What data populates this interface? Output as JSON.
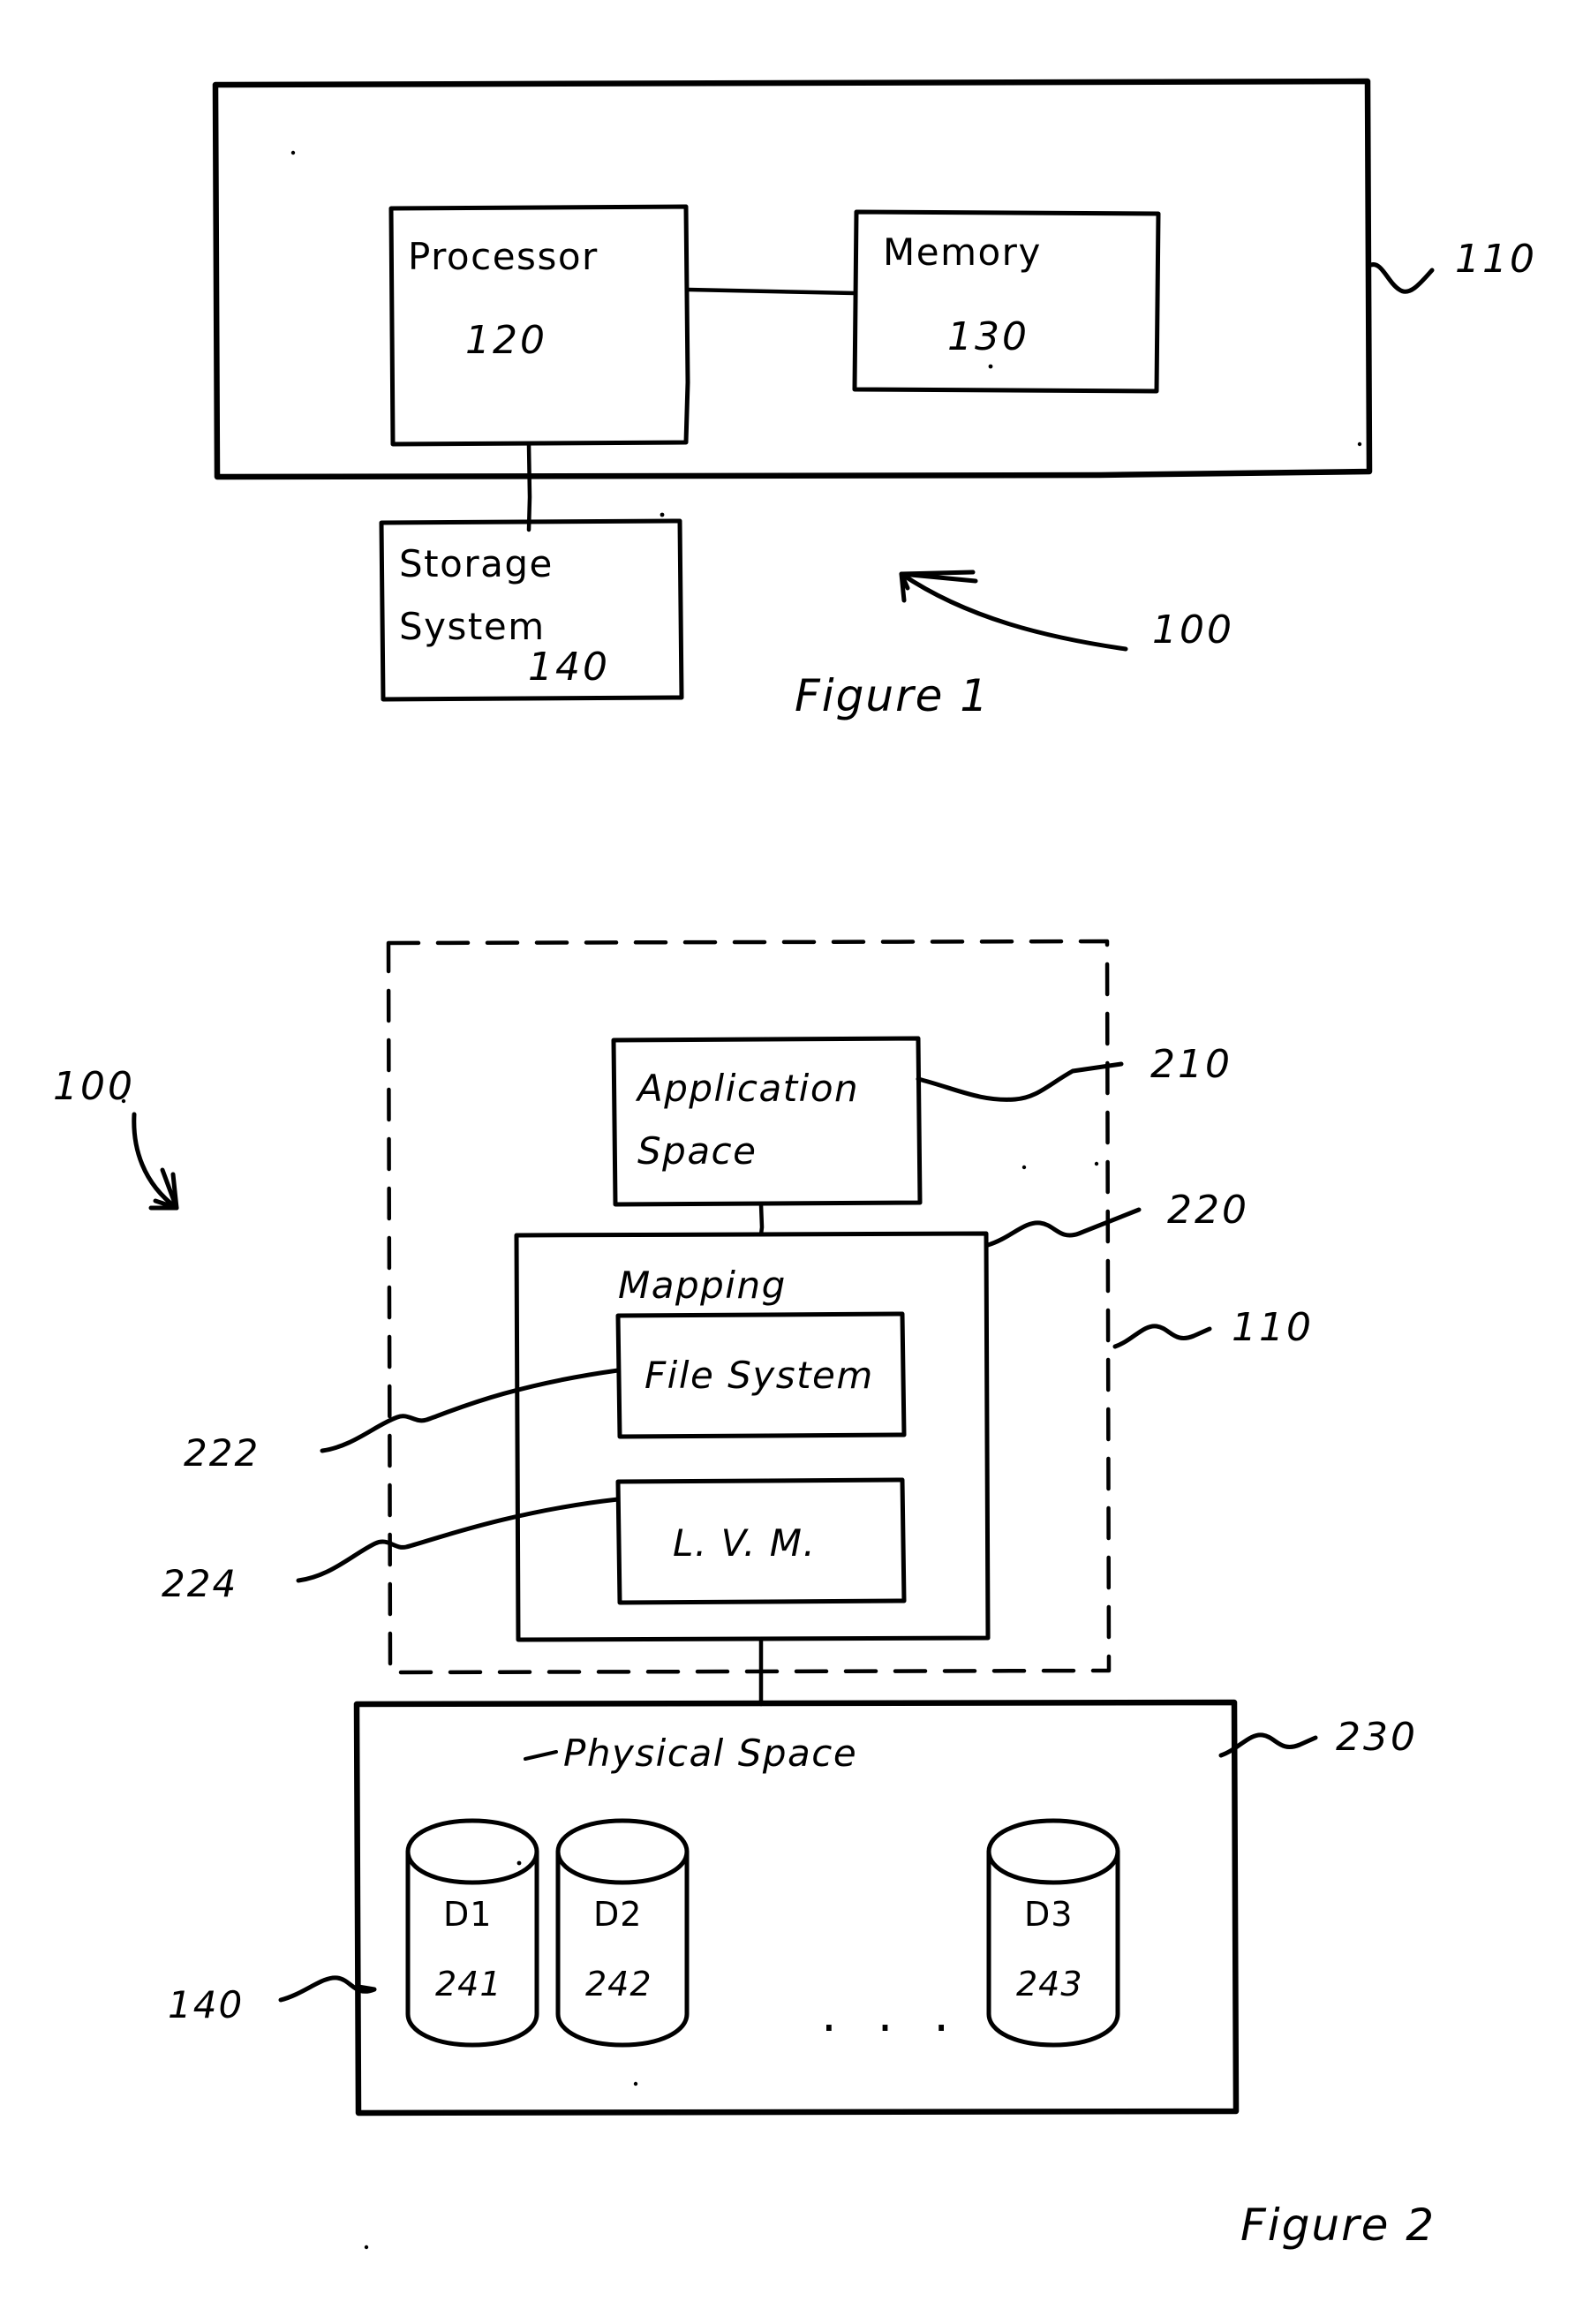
{
  "document": {
    "type": "patent-figure-sheet",
    "background_color": "#ffffff",
    "ink_color": "#000000"
  },
  "figure1": {
    "caption": "Figure 1",
    "system_callout": "100",
    "computer_callout": "110",
    "boxes": {
      "processor": {
        "label": "Processor",
        "number": "120"
      },
      "memory": {
        "label": "Memory",
        "number": "130"
      },
      "storage": {
        "label_line1": "Storage",
        "label_line2": "System",
        "number": "140"
      }
    }
  },
  "figure2": {
    "caption": "Figure 2",
    "system_callout": "100",
    "computer_callout": "110",
    "boxes": {
      "application_space": {
        "label_line1": "Application",
        "label_line2": "Space",
        "number": "210"
      },
      "mapping": {
        "label": "Mapping",
        "number": "220"
      },
      "file_system": {
        "label": "File System",
        "number": "222"
      },
      "lvm": {
        "label": "L. V. M.",
        "number": "224"
      },
      "physical_space": {
        "label": "Physical  Space",
        "number": "230"
      }
    },
    "storage_callout": "140",
    "disks": [
      {
        "label": "D1",
        "number": "241"
      },
      {
        "label": "D2",
        "number": "242"
      },
      {
        "label": "D3",
        "number": "243"
      }
    ],
    "disks_ellipsis": ". . ."
  }
}
